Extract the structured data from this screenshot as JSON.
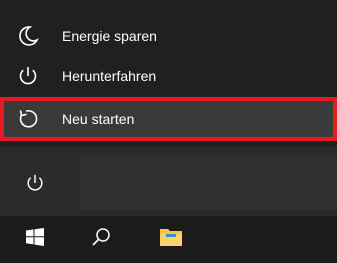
{
  "power_menu": {
    "items": [
      {
        "label": "Energie sparen",
        "icon": "moon-icon"
      },
      {
        "label": "Herunterfahren",
        "icon": "power-icon"
      },
      {
        "label": "Neu starten",
        "icon": "restart-icon",
        "highlight_color": "#e8191f"
      }
    ]
  },
  "start_panel": {
    "power_button_icon": "power-icon"
  },
  "taskbar": {
    "items": [
      {
        "icon": "windows-start-icon"
      },
      {
        "icon": "search-icon"
      },
      {
        "icon": "file-explorer-icon"
      }
    ]
  },
  "colors": {
    "menu_background": "#202020",
    "taskbar_background": "#1b1b1b",
    "highlight_border": "#e8191f",
    "folder_yellow": "#f5c84c"
  }
}
